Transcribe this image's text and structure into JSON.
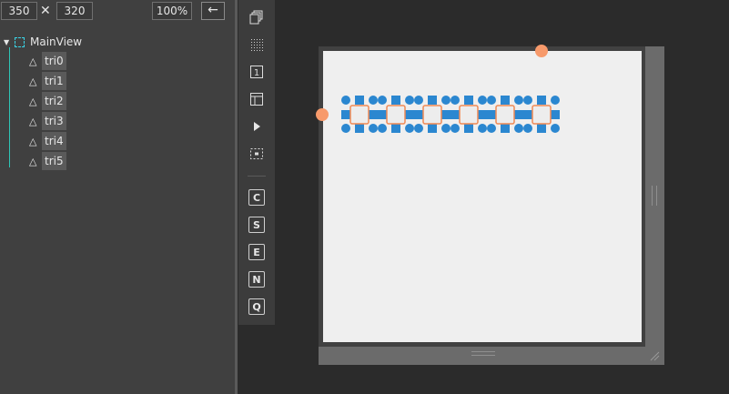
{
  "size_bar": {
    "width": "350",
    "height": "320",
    "times": "✕",
    "zoom": "100%",
    "back": "←"
  },
  "tree": {
    "root": {
      "label": "MainView"
    },
    "items": [
      {
        "label": "tri0"
      },
      {
        "label": "tri1"
      },
      {
        "label": "tri2"
      },
      {
        "label": "tri3"
      },
      {
        "label": "tri4"
      },
      {
        "label": "tri5"
      }
    ],
    "item_icon": "△"
  },
  "toolbar": {
    "buttons": [
      {
        "name": "copy-layers-icon"
      },
      {
        "name": "grid-icon"
      },
      {
        "name": "number-one-icon",
        "label": "1"
      },
      {
        "name": "layout-panel-icon"
      },
      {
        "name": "play-icon"
      },
      {
        "name": "focus-frame-icon"
      }
    ],
    "letters": [
      "C",
      "S",
      "E",
      "N",
      "Q"
    ]
  },
  "colors": {
    "accent_teal": "#2ec4b6",
    "shape_blue": "#2b87d0",
    "handle_orange": "#f79a6b",
    "canvas": "#efefef"
  }
}
